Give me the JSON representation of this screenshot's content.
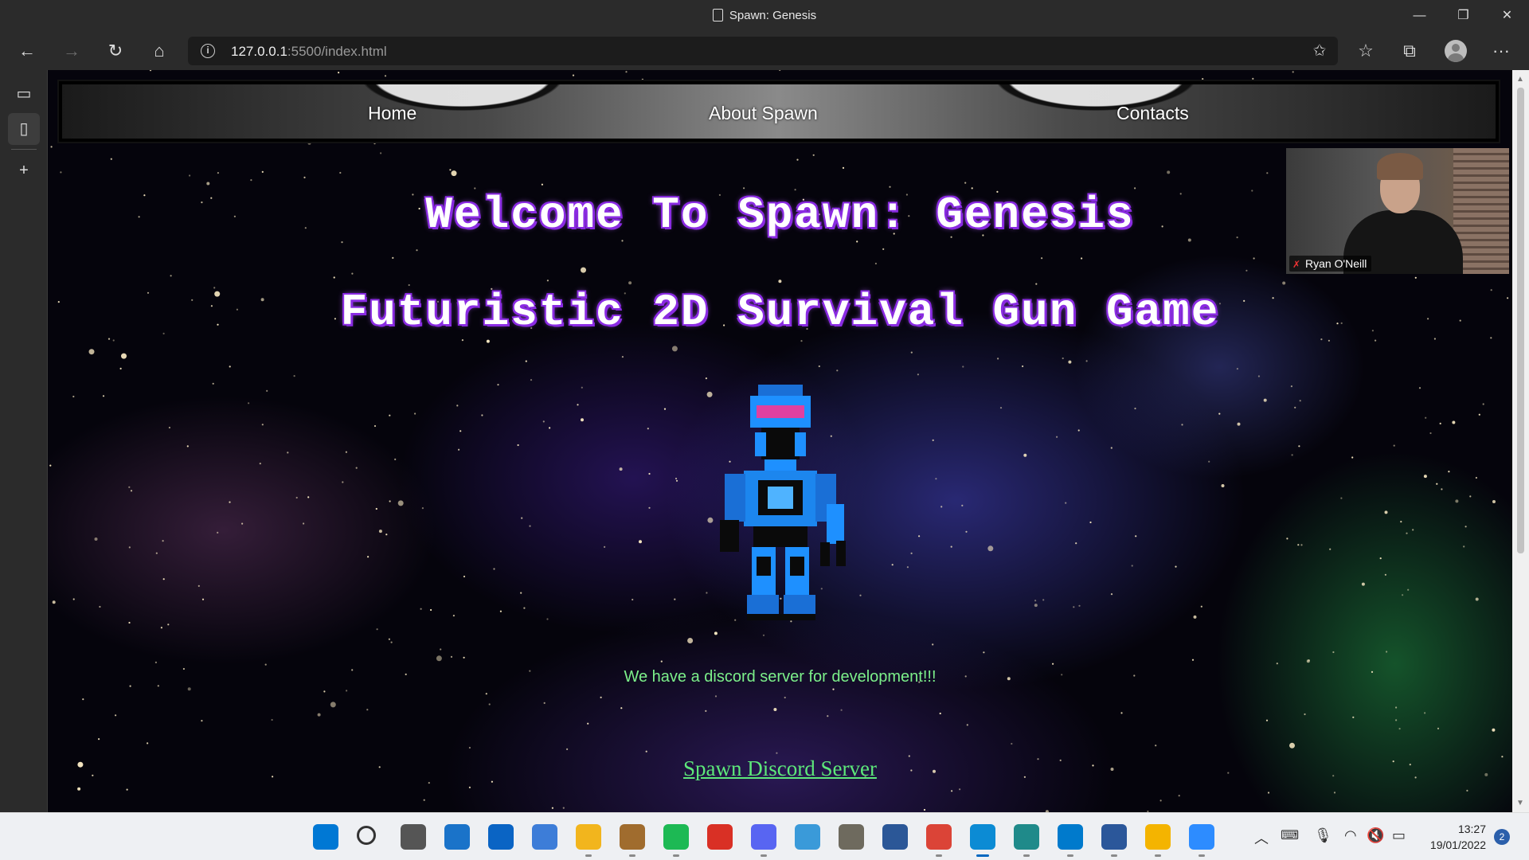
{
  "window": {
    "title": "Spawn: Genesis",
    "controls": {
      "minimize": "—",
      "maximize": "❐",
      "close": "✕"
    }
  },
  "toolbar": {
    "back": "←",
    "forward": "→",
    "refresh": "↻",
    "home": "⌂",
    "url_host": "127.0.0.1",
    "url_rest": ":5500/index.html",
    "favorites": "☆",
    "collections": "⧉",
    "more": "···"
  },
  "page": {
    "nav": [
      "Home",
      "About Spawn",
      "Contacts"
    ],
    "title": "Welcome To Spawn: Genesis",
    "subtitle": "Futuristic 2D Survival Gun Game",
    "discord_text": "We have a discord server for development!!!",
    "discord_link": "Spawn Discord Server"
  },
  "video_call": {
    "participant": "Ryan O'Neill"
  },
  "taskbar": {
    "time": "13:27",
    "date": "19/01/2022",
    "notifications": "2",
    "icons": [
      "windows-start",
      "search",
      "task-view",
      "widgets",
      "mail",
      "notepad",
      "file-explorer",
      "game-app",
      "spotify",
      "game-launcher",
      "discord",
      "paint",
      "gimp",
      "store",
      "chrome",
      "edge",
      "snipping-tool",
      "vscode",
      "word",
      "chrome-2",
      "zoom"
    ]
  },
  "colors": {
    "title_glow": "#8a2be2",
    "discord_green": "#7cf08a",
    "edge_active": "#0067c0"
  }
}
